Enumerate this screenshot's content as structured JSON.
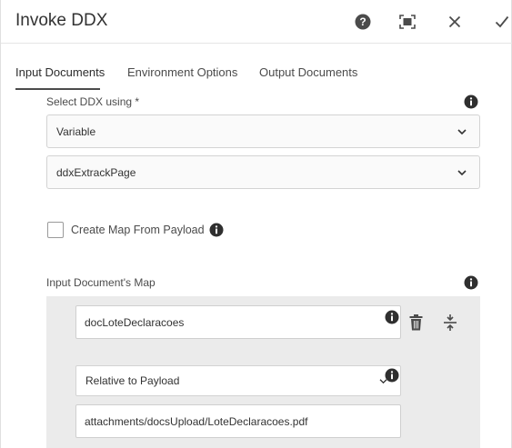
{
  "dialog": {
    "title": "Invoke DDX",
    "actions": {
      "help": "help-icon",
      "fullscreen": "fullscreen-icon",
      "close": "close-icon",
      "done": "checkmark-icon"
    }
  },
  "tabs": [
    {
      "label": "Input Documents",
      "active": true
    },
    {
      "label": "Environment Options",
      "active": false
    },
    {
      "label": "Output Documents",
      "active": false
    }
  ],
  "form": {
    "select_ddx_label": "Select DDX using *",
    "select_ddx_value": "Variable",
    "ddx_variable_value": "ddxExtrackPage",
    "create_map_label": "Create Map From Payload",
    "create_map_checked": false,
    "input_map_label": "Input Document's Map",
    "map_entries": [
      {
        "name_value": "docLoteDeclaracoes",
        "source_value": "Relative to Payload",
        "path_value": "attachments/docsUpload/LoteDeclaracoes.pdf"
      }
    ]
  },
  "colors": {
    "accent": "#4b4b4b",
    "panel": "#ebebeb",
    "field_bg": "#fafafa"
  }
}
